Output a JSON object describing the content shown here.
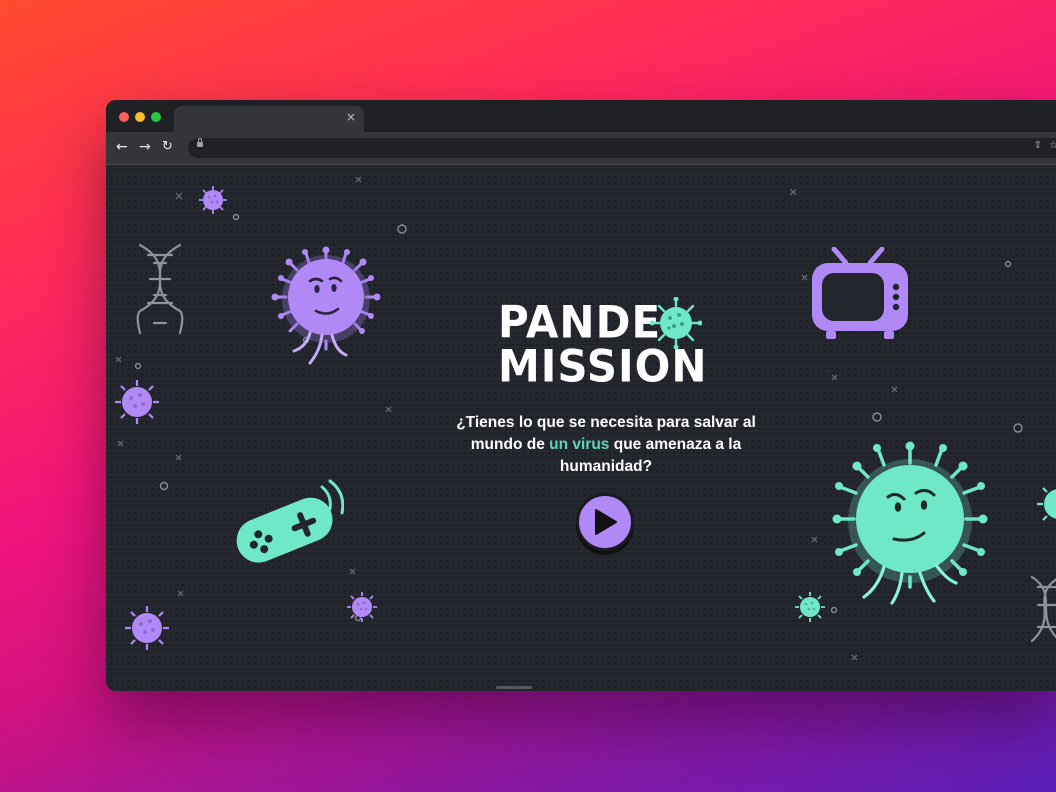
{
  "browser": {
    "tab_title": "",
    "tab_close": "×",
    "back": "←",
    "forward": "→",
    "reload": "↻",
    "share": "⇪",
    "bookmark": "☆"
  },
  "hero": {
    "logo_line1": "PANDE",
    "logo_line2": "MISSION",
    "tagline_before": "¿Tienes lo que se necesita para salvar al mundo de ",
    "tagline_highlight": "un virus",
    "tagline_after": " que amenaza a la humanidad?"
  },
  "colors": {
    "purple": "#b089f6",
    "mint": "#6ee8c6",
    "highlight": "#5fd6b6",
    "background": "#23252d"
  },
  "icons": [
    "virus-icon",
    "dna-icon",
    "tv-icon",
    "gamepad-icon",
    "play-icon"
  ]
}
